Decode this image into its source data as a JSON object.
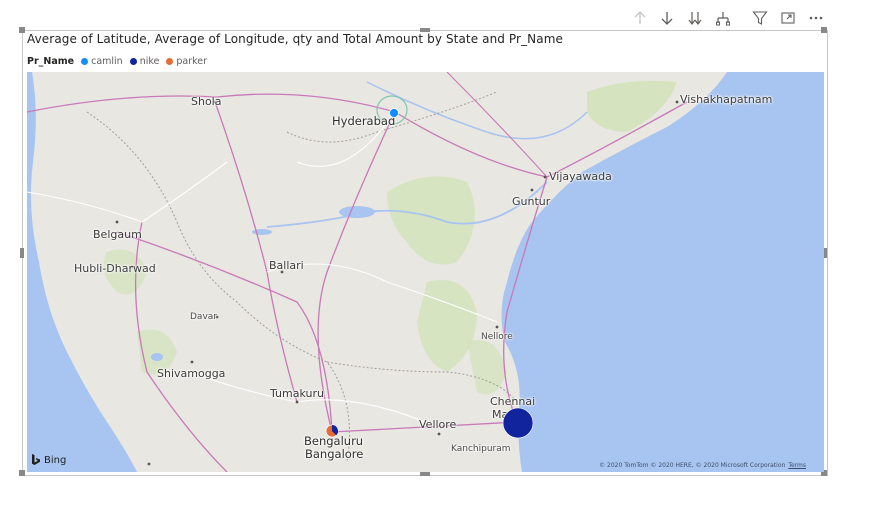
{
  "toolbar": {
    "icons": [
      "arrow-up-icon",
      "arrow-down-icon",
      "double-arrow-down-icon",
      "expand-hierarchy-icon",
      "filter-icon",
      "focus-mode-icon",
      "more-options-icon"
    ]
  },
  "visual": {
    "title": "Average of Latitude, Average of Longitude, qty and Total Amount by State and Pr_Name",
    "legend": {
      "title": "Pr_Name",
      "items": [
        {
          "label": "camlin",
          "color": "#118dff"
        },
        {
          "label": "nike",
          "color": "#12239e"
        },
        {
          "label": "parker",
          "color": "#e66c37"
        }
      ]
    }
  },
  "map": {
    "cities": {
      "shola": "Shola",
      "hyderabad": "Hyderabad",
      "vishakhapatnam": "Vishakhapatnam",
      "vijayawada": "Vijayawada",
      "guntur": "Guntur",
      "belgaum": "Belgaum",
      "hubli": "Hubli-Dharwad",
      "ballari": "Ballari",
      "davar": "Davar",
      "shivamogga": "Shivamogga",
      "nellore": "Nellore",
      "tumakuru": "Tumakuru",
      "chennai1": "Chennai",
      "chennai2": "Ma",
      "bengaluru": "Bengaluru",
      "bangalore": "Bangalore",
      "vellore": "Vellore",
      "kanchipuram": "Kanchipuram"
    },
    "attribution": {
      "provider": "Bing",
      "copyright": "© 2020 TomTom © 2020 HERE, © 2020 Microsoft Corporation",
      "terms": "Terms"
    },
    "colors": {
      "land": "#e9e7e2",
      "water": "#a8c4f0",
      "green": "#cfe3b5",
      "road_major": "#c879b8",
      "road_minor": "#ffffff"
    }
  }
}
